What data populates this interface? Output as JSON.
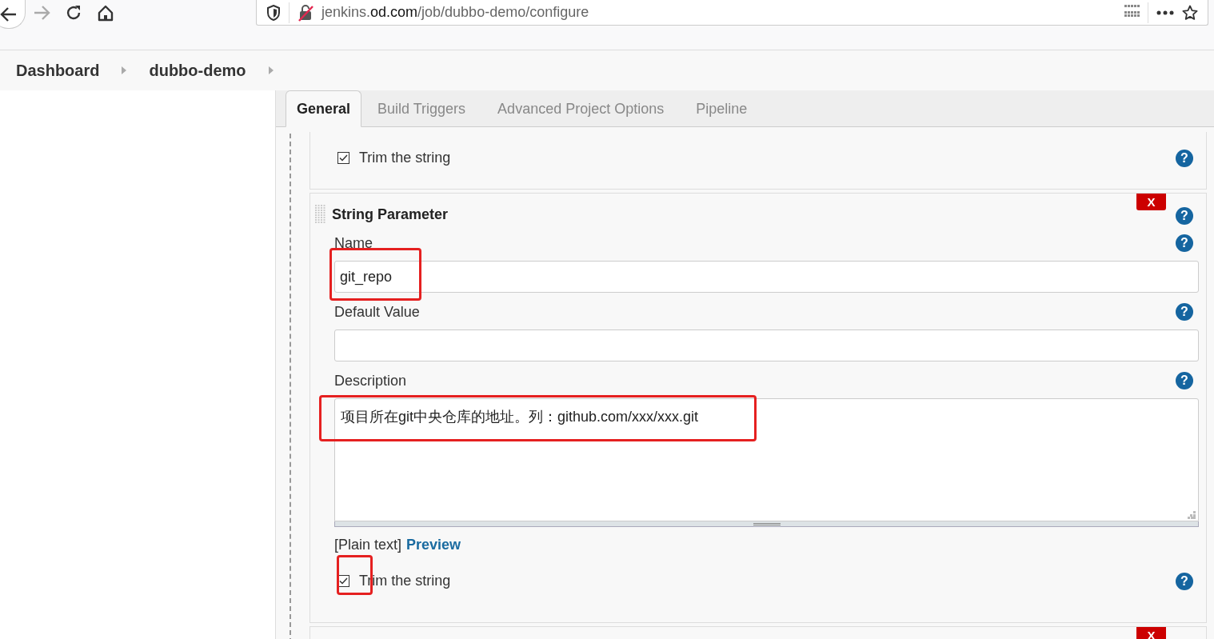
{
  "browser": {
    "url_host_prefix": "jenkins.",
    "url_domain": "od.com",
    "url_path": "/job/dubbo-demo/configure"
  },
  "breadcrumbs": [
    "Dashboard",
    "dubbo-demo"
  ],
  "tabs": [
    {
      "label": "General",
      "selected": true
    },
    {
      "label": "Build Triggers",
      "selected": false
    },
    {
      "label": "Advanced Project Options",
      "selected": false
    },
    {
      "label": "Pipeline",
      "selected": false
    }
  ],
  "sections": [
    {
      "kind": "trim",
      "help": "?",
      "checkbox": {
        "label": "Trim the string",
        "checked": true
      }
    },
    {
      "kind": "string_parameter",
      "title": "String Parameter",
      "help": "?",
      "delete_label": "X",
      "fields": [
        {
          "kind": "text",
          "label": "Name",
          "help": "?",
          "value": "git_repo",
          "highlighted": true
        },
        {
          "kind": "text",
          "label": "Default Value",
          "help": "?"
        },
        {
          "kind": "textarea",
          "label": "Description",
          "help": "?",
          "value": "项目所在git中央仓库的地址。列：github.com/xxx/xxx.git",
          "highlighted": true
        }
      ],
      "format_note": "[Plain text]",
      "preview_link": "Preview",
      "checkbox": {
        "label": "Trim the string",
        "checked": true,
        "highlighted": true,
        "help": "?"
      }
    },
    {
      "kind": "stub",
      "delete_label": "X"
    }
  ]
}
